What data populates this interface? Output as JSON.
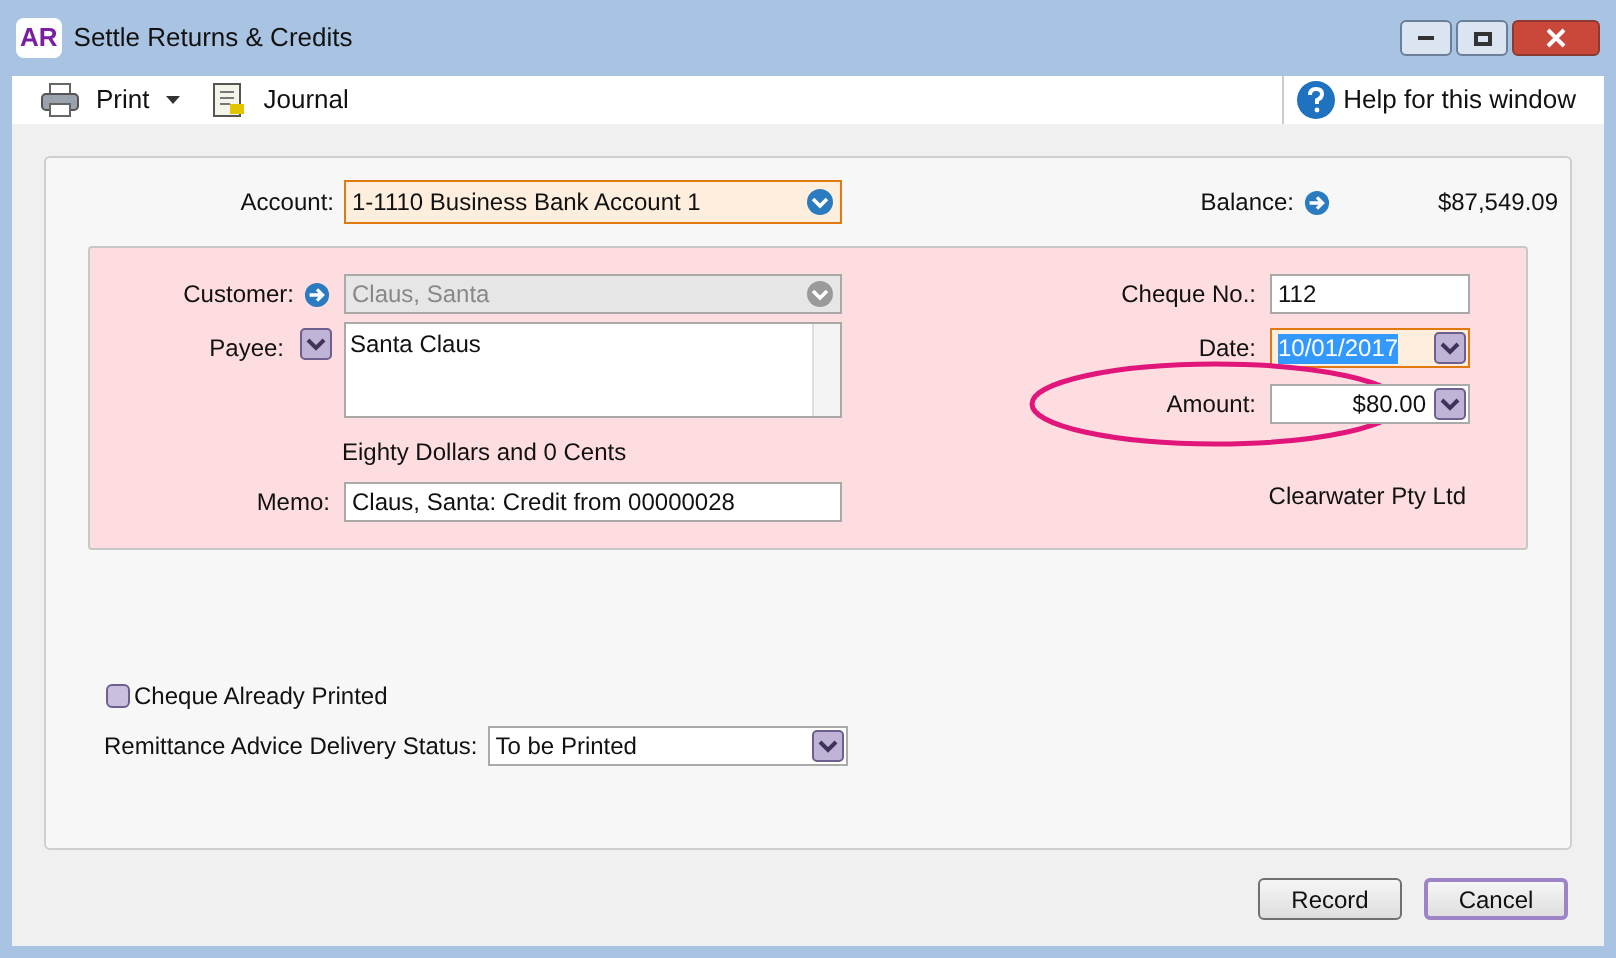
{
  "window": {
    "title": "Settle Returns & Credits",
    "logo": "AR"
  },
  "toolbar": {
    "items": [
      {
        "kind": "print",
        "label": "Print",
        "has_menu": true
      },
      {
        "kind": "journal",
        "label": "Journal",
        "has_menu": false
      }
    ],
    "help": "Help for this window"
  },
  "account": {
    "label": "Account:",
    "value": "1-1110 Business Bank Account 1",
    "focused": true
  },
  "balance": {
    "label": "Balance:",
    "value": "$87,549.09"
  },
  "customer": {
    "label": "Customer:",
    "value": "Claus, Santa",
    "disabled": true
  },
  "payee": {
    "label": "Payee:",
    "value": "Santa Claus"
  },
  "amount_in_words": "Eighty Dollars and 0 Cents",
  "memo": {
    "label": "Memo:",
    "value": "Claus, Santa: Credit from 00000028"
  },
  "cheque_no": {
    "label": "Cheque No.:",
    "value": "112"
  },
  "date": {
    "label": "Date:",
    "value": "10/01/2017",
    "selected": true,
    "focused": true
  },
  "amount": {
    "label": "Amount:",
    "value": "$80.00",
    "circled": true
  },
  "company": "Clearwater Pty Ltd",
  "cheque_printed": {
    "label": "Cheque Already Printed",
    "checked": false
  },
  "remittance": {
    "label": "Remittance Advice Delivery Status:",
    "value": "To be Printed"
  },
  "buttons": [
    {
      "label": "Record",
      "default": false
    },
    {
      "label": "Cancel",
      "default": true
    }
  ]
}
